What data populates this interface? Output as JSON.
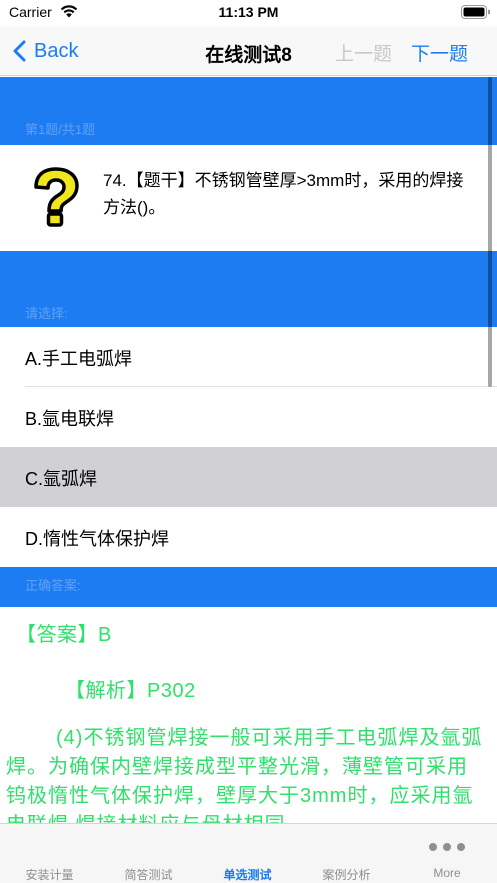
{
  "status_bar": {
    "carrier": "Carrier",
    "time": "11:13 PM",
    "icons": [
      "wifi-icon",
      "battery-icon"
    ]
  },
  "nav": {
    "back_label": "Back",
    "title": "在线测试8",
    "prev_label": "上一题",
    "next_label": "下一题",
    "accent_color": "#1a7cf5",
    "disabled_color": "#c7c7cc"
  },
  "question": {
    "section_label": "第1题/共1题",
    "icon": "question-mark-icon",
    "text": "74.【题干】不锈钢管壁厚>3mm时，采用的焊接方法()。"
  },
  "options": {
    "section_label": "请选择:",
    "items": [
      {
        "label": "A.手工电弧焊"
      },
      {
        "label": "B.氩电联焊"
      },
      {
        "label": "C.氩弧焊"
      },
      {
        "label": "D.惰性气体保护焊"
      }
    ],
    "selected_index": 2
  },
  "answer": {
    "section_label": "正确答案:",
    "answer_line": "【答案】B",
    "analysis_line": "【解析】P302",
    "explanation": "(4)不锈钢管焊接一般可采用手工电弧焊及氩弧焊。为确保内壁焊接成型平整光滑，薄壁管可采用钨极惰性气体保护焊，壁厚大于3mm时，应采用氩电联焊,焊接材料应与母材相同。",
    "text_color": "#2fe06b"
  },
  "tabs": [
    {
      "label": "安装计量"
    },
    {
      "label": "简答测试"
    },
    {
      "label": "单选测试"
    },
    {
      "label": "案例分析"
    },
    {
      "label": "More",
      "icon": "more-dots-icon"
    }
  ],
  "active_tab_index": 2,
  "band_color": "#1d7cf2"
}
